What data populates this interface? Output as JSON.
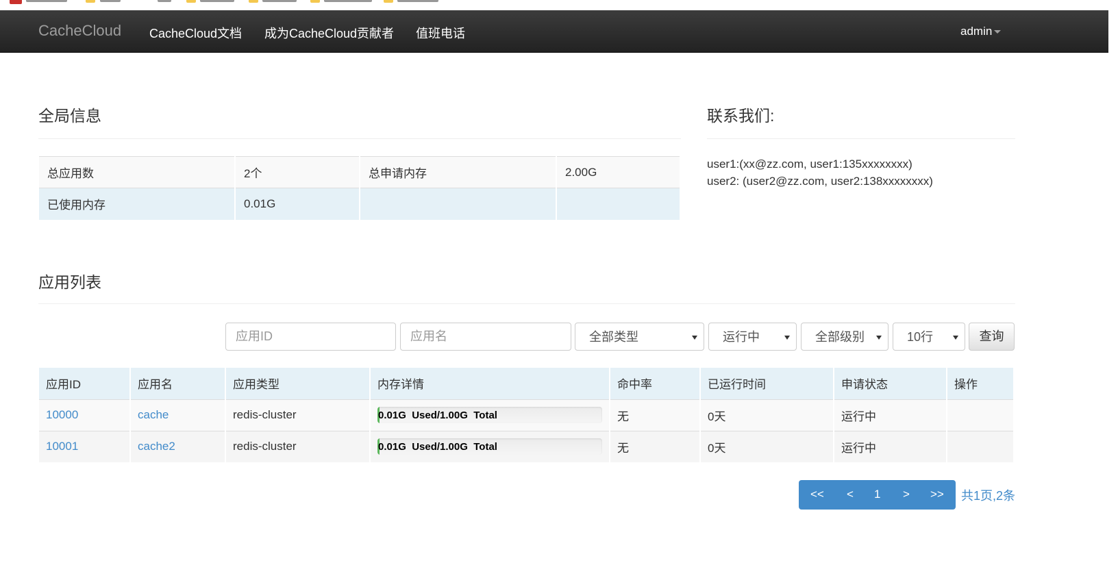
{
  "navbar": {
    "brand": "CacheCloud",
    "links": [
      "CacheCloud文档",
      "成为CacheCloud贡献者",
      "值班电话"
    ],
    "user": "admin"
  },
  "global_info": {
    "title": "全局信息",
    "rows": [
      [
        "总应用数",
        "2个",
        "总申请内存",
        "2.00G"
      ],
      [
        "已使用内存",
        "0.01G",
        "",
        ""
      ]
    ]
  },
  "contact": {
    "title": "联系我们:",
    "lines": [
      "user1:(xx@zz.com, user1:135xxxxxxxx)",
      "user2: (user2@zz.com, user2:138xxxxxxxx)"
    ]
  },
  "app_list": {
    "title": "应用列表",
    "filters": {
      "app_id_placeholder": "应用ID",
      "app_name_placeholder": "应用名",
      "type_selected": "全部类型",
      "status_selected": "运行中",
      "level_selected": "全部级别",
      "rows_selected": "10行",
      "query_label": "查询"
    },
    "columns": [
      "应用ID",
      "应用名",
      "应用类型",
      "内存详情",
      "命中率",
      "已运行时间",
      "申请状态",
      "操作"
    ],
    "rows": [
      {
        "id": "10000",
        "name": "cache",
        "type": "redis-cluster",
        "memory_text": "0.01G  Used/1.00G  Total",
        "memory_used_fraction": 0.01,
        "hit_rate": "无",
        "uptime": "0天",
        "status": "运行中",
        "ops": ""
      },
      {
        "id": "10001",
        "name": "cache2",
        "type": "redis-cluster",
        "memory_text": "0.01G  Used/1.00G  Total",
        "memory_used_fraction": 0.01,
        "hit_rate": "无",
        "uptime": "0天",
        "status": "运行中",
        "ops": ""
      }
    ],
    "pagination": {
      "first": "<<",
      "prev": "<",
      "current": "1",
      "next": ">",
      "last": ">>",
      "summary": "共1页,2条"
    }
  },
  "colors": {
    "navbar": "#222222",
    "link": "#428bca",
    "table_header": "#e5f1f7",
    "progress_bar": "#5cb85c"
  }
}
